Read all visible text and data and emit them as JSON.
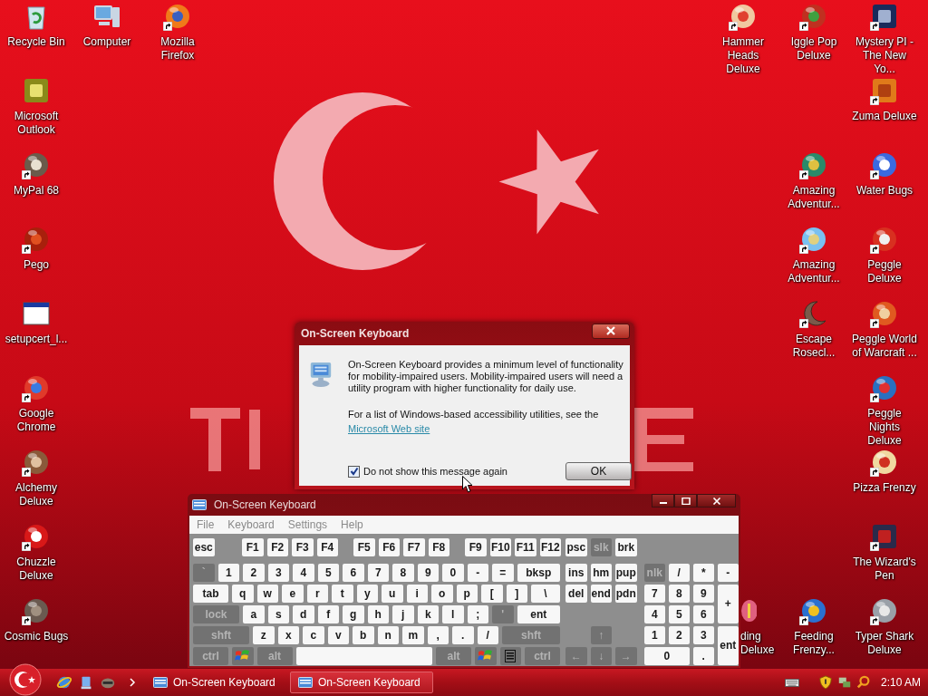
{
  "desktop": {
    "icons": [
      {
        "label": "Recycle Bin",
        "shortcut": false
      },
      {
        "label": "Computer",
        "shortcut": false
      },
      {
        "label": "Mozilla Firefox",
        "shortcut": true
      },
      {
        "label": "Microsoft Outlook",
        "shortcut": false
      },
      {
        "label": "MyPal 68",
        "shortcut": true
      },
      {
        "label": "Pego",
        "shortcut": true
      },
      {
        "label": "setupcert_l...",
        "shortcut": false
      },
      {
        "label": "Google Chrome",
        "shortcut": true
      },
      {
        "label": "Alchemy Deluxe",
        "shortcut": true
      },
      {
        "label": "Chuzzle Deluxe",
        "shortcut": true
      },
      {
        "label": "Cosmic Bugs",
        "shortcut": true
      },
      {
        "label": "Hammer Heads Deluxe",
        "shortcut": true
      },
      {
        "label": "Iggle Pop Deluxe",
        "shortcut": true
      },
      {
        "label": "Mystery PI - The New Yo...",
        "shortcut": true
      },
      {
        "label": "Zuma Deluxe",
        "shortcut": true
      },
      {
        "label": "Amazing Adventur...",
        "shortcut": true
      },
      {
        "label": "Water Bugs",
        "shortcut": true
      },
      {
        "label": "Amazing Adventur...",
        "shortcut": true
      },
      {
        "label": "Peggle Deluxe",
        "shortcut": true
      },
      {
        "label": "Escape Rosecl...",
        "shortcut": true
      },
      {
        "label": "Peggle World of Warcraft ...",
        "shortcut": true
      },
      {
        "label": "Peggle Nights Deluxe",
        "shortcut": true
      },
      {
        "label": "Pizza Frenzy",
        "shortcut": true
      },
      {
        "label": "The Wizard's Pen",
        "shortcut": true
      },
      {
        "label": "ding Deluxe",
        "shortcut": false
      },
      {
        "label": "Feeding Frenzy...",
        "shortcut": true
      },
      {
        "label": "Typer Shark Deluxe",
        "shortcut": true
      }
    ]
  },
  "dialog": {
    "title": "On-Screen Keyboard",
    "message": "On-Screen Keyboard provides a minimum level of functionality for mobility-impaired users. Mobility-impaired users will need a utility program with higher functionality for daily use.",
    "note": "For a list of Windows-based accessibility utilities, see the",
    "link": "Microsoft Web site",
    "checkbox": {
      "label": "Do not show this message again",
      "checked": true
    },
    "button": "OK"
  },
  "keyboard": {
    "title": "On-Screen Keyboard",
    "menu": [
      {
        "label": "File",
        "disabled": true
      },
      {
        "label": "Keyboard",
        "disabled": true
      },
      {
        "label": "Settings",
        "disabled": true
      },
      {
        "label": "Help",
        "disabled": true
      }
    ],
    "main_rows": [
      [
        {
          "label": "esc",
          "kind": "light"
        },
        {
          "label": "F1",
          "kind": "light"
        },
        {
          "label": "F2",
          "kind": "light"
        },
        {
          "label": "F3",
          "kind": "light"
        },
        {
          "label": "F4",
          "kind": "light"
        },
        {
          "label": "F5",
          "kind": "light"
        },
        {
          "label": "F6",
          "kind": "light"
        },
        {
          "label": "F7",
          "kind": "light"
        },
        {
          "label": "F8",
          "kind": "light"
        },
        {
          "label": "F9",
          "kind": "light"
        },
        {
          "label": "F10",
          "kind": "light"
        },
        {
          "label": "F11",
          "kind": "light"
        },
        {
          "label": "F12",
          "kind": "light"
        }
      ],
      [
        {
          "label": "`",
          "kind": "dark"
        },
        {
          "label": "1",
          "kind": "light"
        },
        {
          "label": "2",
          "kind": "light"
        },
        {
          "label": "3",
          "kind": "light"
        },
        {
          "label": "4",
          "kind": "light"
        },
        {
          "label": "5",
          "kind": "light"
        },
        {
          "label": "6",
          "kind": "light"
        },
        {
          "label": "7",
          "kind": "light"
        },
        {
          "label": "8",
          "kind": "light"
        },
        {
          "label": "9",
          "kind": "light"
        },
        {
          "label": "0",
          "kind": "light"
        },
        {
          "label": "-",
          "kind": "light"
        },
        {
          "label": "=",
          "kind": "light"
        },
        {
          "label": "bksp",
          "kind": "light"
        }
      ],
      [
        {
          "label": "tab",
          "kind": "light"
        },
        {
          "label": "q",
          "kind": "light"
        },
        {
          "label": "w",
          "kind": "light"
        },
        {
          "label": "e",
          "kind": "light"
        },
        {
          "label": "r",
          "kind": "light"
        },
        {
          "label": "t",
          "kind": "light"
        },
        {
          "label": "y",
          "kind": "light"
        },
        {
          "label": "u",
          "kind": "light"
        },
        {
          "label": "i",
          "kind": "light"
        },
        {
          "label": "o",
          "kind": "light"
        },
        {
          "label": "p",
          "kind": "light"
        },
        {
          "label": "[",
          "kind": "light"
        },
        {
          "label": "]",
          "kind": "light"
        },
        {
          "label": "\\",
          "kind": "light"
        }
      ],
      [
        {
          "label": "lock",
          "kind": "dark"
        },
        {
          "label": "a",
          "kind": "light"
        },
        {
          "label": "s",
          "kind": "light"
        },
        {
          "label": "d",
          "kind": "light"
        },
        {
          "label": "f",
          "kind": "light"
        },
        {
          "label": "g",
          "kind": "light"
        },
        {
          "label": "h",
          "kind": "light"
        },
        {
          "label": "j",
          "kind": "light"
        },
        {
          "label": "k",
          "kind": "light"
        },
        {
          "label": "l",
          "kind": "light"
        },
        {
          "label": ";",
          "kind": "light"
        },
        {
          "label": "'",
          "kind": "dark"
        },
        {
          "label": "ent",
          "kind": "light"
        }
      ],
      [
        {
          "label": "shft",
          "kind": "dark"
        },
        {
          "label": "z",
          "kind": "light"
        },
        {
          "label": "x",
          "kind": "light"
        },
        {
          "label": "c",
          "kind": "light"
        },
        {
          "label": "v",
          "kind": "light"
        },
        {
          "label": "b",
          "kind": "light"
        },
        {
          "label": "n",
          "kind": "light"
        },
        {
          "label": "m",
          "kind": "light"
        },
        {
          "label": ",",
          "kind": "light"
        },
        {
          "label": ".",
          "kind": "light"
        },
        {
          "label": "/",
          "kind": "light"
        },
        {
          "label": "shft",
          "kind": "dark"
        }
      ],
      [
        {
          "label": "ctrl",
          "kind": "dark"
        },
        {
          "kind": "logo"
        },
        {
          "label": "alt",
          "kind": "dark"
        },
        {
          "kind": "space"
        },
        {
          "label": "alt",
          "kind": "dark"
        },
        {
          "kind": "logo"
        },
        {
          "kind": "menu"
        },
        {
          "label": "ctrl",
          "kind": "dark"
        }
      ]
    ],
    "nav_rows": [
      [
        {
          "label": "psc",
          "kind": "light"
        },
        {
          "label": "slk",
          "kind": "dark"
        },
        {
          "label": "brk",
          "kind": "light"
        }
      ],
      [
        {
          "label": "ins",
          "kind": "light"
        },
        {
          "label": "hm",
          "kind": "light"
        },
        {
          "label": "pup",
          "kind": "light"
        }
      ],
      [
        {
          "label": "del",
          "kind": "light"
        },
        {
          "label": "end",
          "kind": "light"
        },
        {
          "label": "pdn",
          "kind": "light"
        }
      ],
      [
        {
          "label": "↑",
          "kind": "dark"
        }
      ],
      [
        {
          "label": "←",
          "kind": "dark"
        },
        {
          "label": "↓",
          "kind": "dark"
        },
        {
          "label": "→",
          "kind": "dark"
        }
      ]
    ],
    "numpad": [
      {
        "label": "nlk",
        "kind": "dark"
      },
      {
        "label": "/",
        "kind": "light"
      },
      {
        "label": "*",
        "kind": "light"
      },
      {
        "label": "-",
        "kind": "light"
      },
      {
        "label": "7",
        "kind": "light"
      },
      {
        "label": "8",
        "kind": "light"
      },
      {
        "label": "9",
        "kind": "light"
      },
      {
        "label": "+",
        "kind": "light"
      },
      {
        "label": "4",
        "kind": "light"
      },
      {
        "label": "5",
        "kind": "light"
      },
      {
        "label": "6",
        "kind": "light"
      },
      {
        "label": "1",
        "kind": "light"
      },
      {
        "label": "2",
        "kind": "light"
      },
      {
        "label": "3",
        "kind": "light"
      },
      {
        "label": "ent",
        "kind": "light"
      },
      {
        "label": "0",
        "kind": "light"
      },
      {
        "label": ".",
        "kind": "light"
      }
    ]
  },
  "taskbar": {
    "tasks": [
      {
        "label": "On-Screen Keyboard",
        "selected": false
      },
      {
        "label": "On-Screen Keyboard",
        "selected": true
      }
    ],
    "clock": "2:10 AM"
  }
}
